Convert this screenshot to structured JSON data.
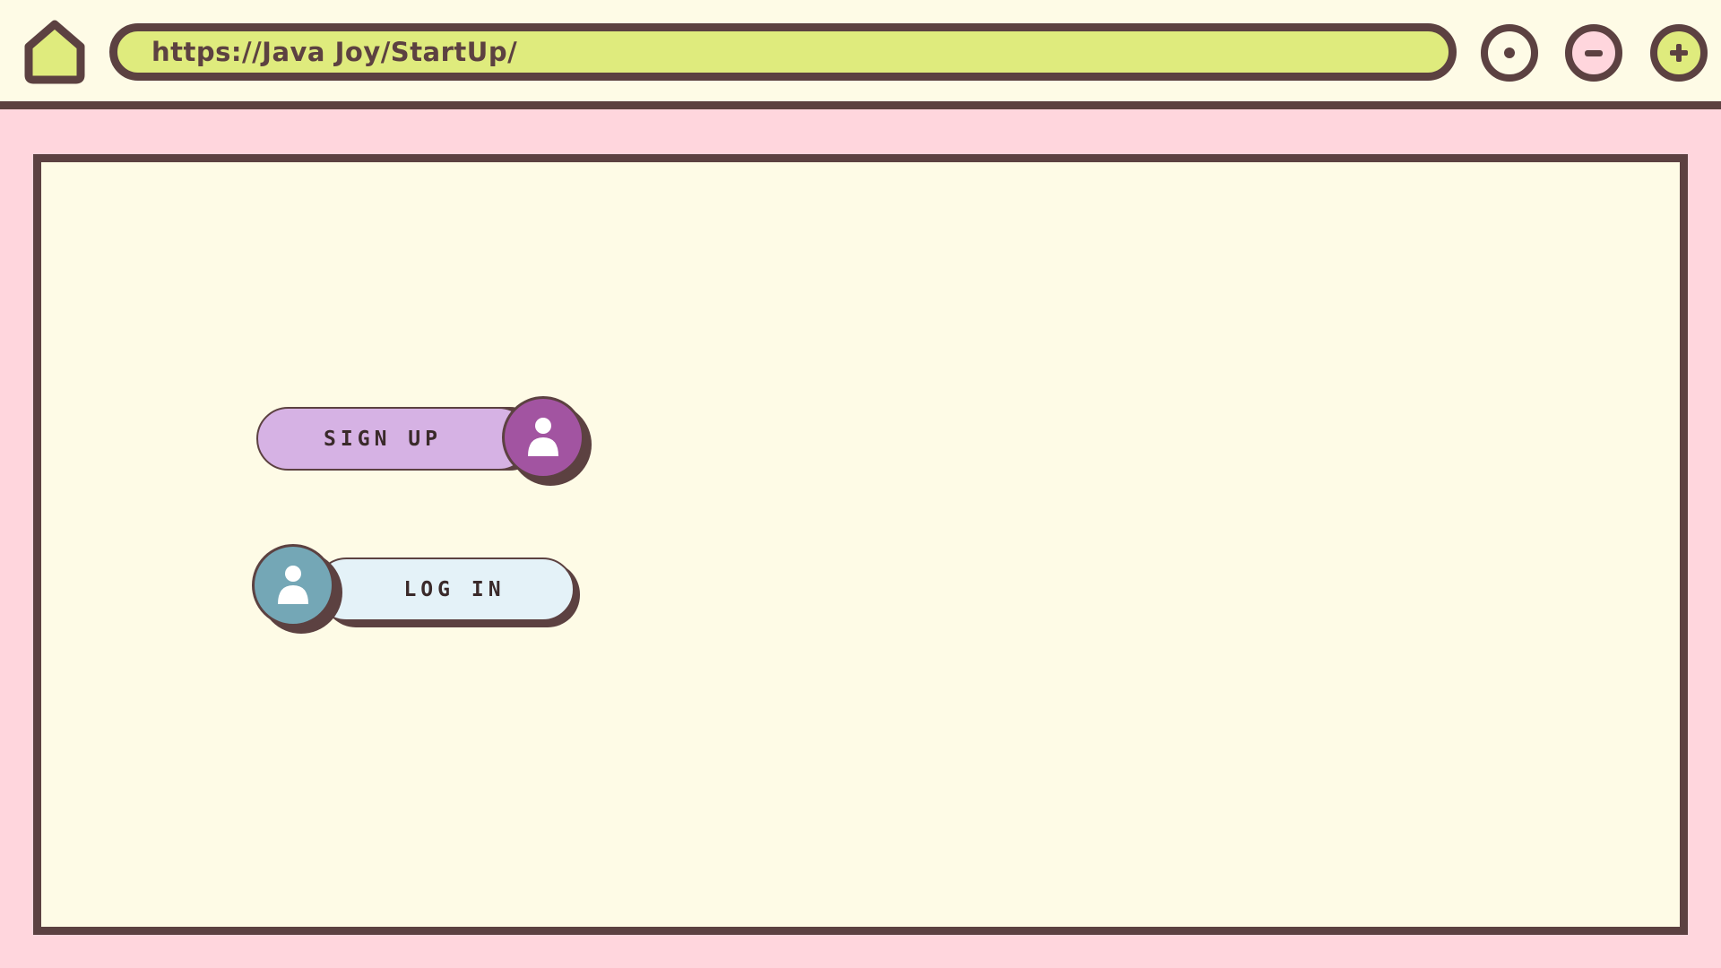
{
  "browser": {
    "url": "https://Java Joy/StartUp/",
    "icons": {
      "home": "home-icon",
      "circle": "circle-dot-icon",
      "minimize": "minus-icon",
      "maximize": "plus-icon"
    }
  },
  "actions": {
    "signup_label": "SIGN UP",
    "login_label": "LOG IN",
    "signup_icon": "user-icon",
    "login_icon": "user-icon"
  },
  "colors": {
    "outline": "#5c4141",
    "bar_background": "#fefbe6",
    "page_background": "#ffd6dd",
    "address_bar": "#dfeb7d",
    "signup_pill": "#d6b2e4",
    "signup_avatar": "#a254a1",
    "login_pill": "#e4f2f8",
    "login_avatar": "#74a7b6"
  }
}
